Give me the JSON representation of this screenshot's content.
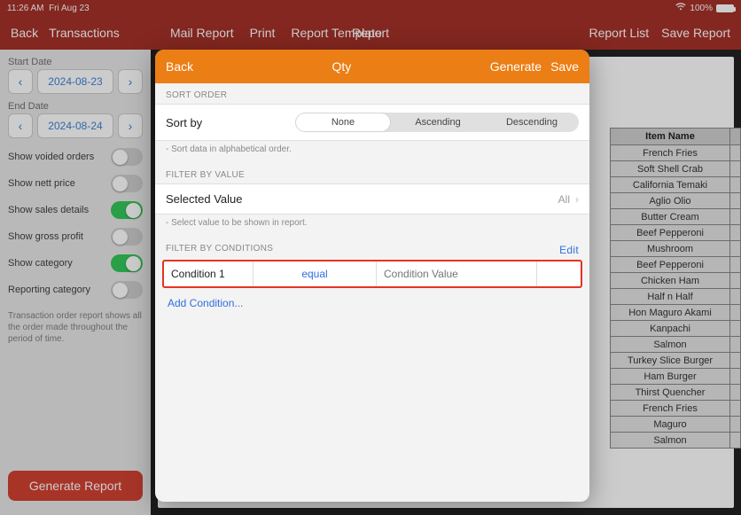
{
  "statusbar": {
    "time": "11:26 AM",
    "date": "Fri Aug 23",
    "battery": "100%"
  },
  "nav": {
    "back": "Back",
    "title": "Transactions",
    "mail": "Mail Report",
    "print": "Print",
    "template": "Report Template",
    "center": "Report",
    "list": "Report List",
    "save": "Save Report"
  },
  "sidebar": {
    "start_label": "Start Date",
    "end_label": "End Date",
    "start_date": "2024-08-23",
    "end_date": "2024-08-24",
    "toggles": {
      "voided": "Show voided orders",
      "nett": "Show nett price",
      "sales": "Show sales details",
      "gross": "Show gross profit",
      "category": "Show category",
      "reportcat": "Reporting category"
    },
    "desc": "Transaction order report shows all the order made throughout the period of time.",
    "generate": "Generate Report"
  },
  "table": {
    "header": "Item Name",
    "rows": [
      "French Fries",
      "Soft Shell Crab",
      "California Temaki",
      "Aglio Olio",
      "Butter Cream",
      "Beef Pepperoni",
      "Mushroom",
      "Beef Pepperoni",
      "Chicken Ham",
      "Half n Half",
      "Hon Maguro Akami",
      "Kanpachi",
      "Salmon",
      "Turkey Slice Burger",
      "Ham Burger",
      "Thirst Quencher",
      "French Fries",
      "Maguro",
      "Salmon"
    ]
  },
  "modal": {
    "back": "Back",
    "title": "Qty",
    "generate": "Generate",
    "save": "Save",
    "sort_section": "SORT ORDER",
    "sortby": "Sort by",
    "seg_none": "None",
    "seg_asc": "Ascending",
    "seg_desc": "Descending",
    "sort_hint": "- Sort data in alphabetical order.",
    "filter_value_section": "FILTER BY VALUE",
    "selected_value": "Selected Value",
    "selected_value_val": "All",
    "sel_hint": "- Select value to be shown in report.",
    "filter_cond_section": "FILTER BY CONDITIONS",
    "edit": "Edit",
    "cond_name": "Condition 1",
    "cond_op": "equal",
    "cond_placeholder": "Condition Value",
    "add_cond": "Add Condition..."
  }
}
